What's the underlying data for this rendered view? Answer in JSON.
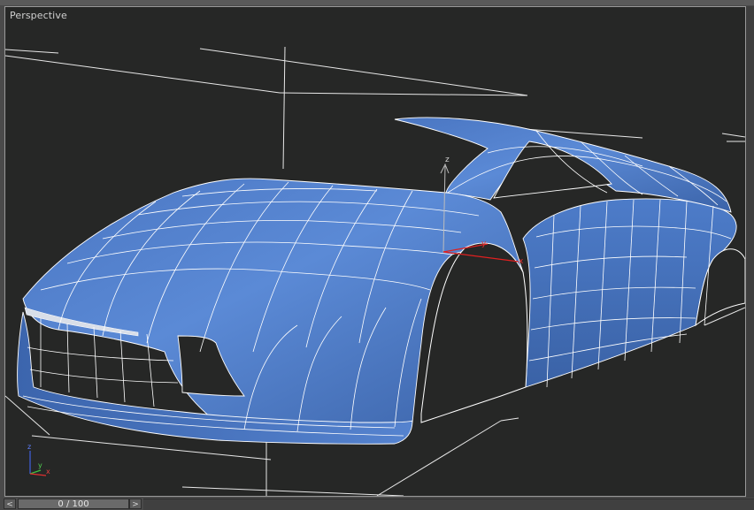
{
  "viewport": {
    "label": "Perspective",
    "background": "#262726",
    "mesh_color": "#4f7fcf",
    "wire_color": "#ffffff"
  },
  "gizmo": {
    "z_label": "z",
    "y_label": "y",
    "x_label": "x"
  },
  "view_axis": {
    "z_label": "z",
    "y_label": "y",
    "x_label": "x"
  },
  "timebar": {
    "prev_label": "<",
    "next_label": ">",
    "frame_text": "0 / 100"
  }
}
